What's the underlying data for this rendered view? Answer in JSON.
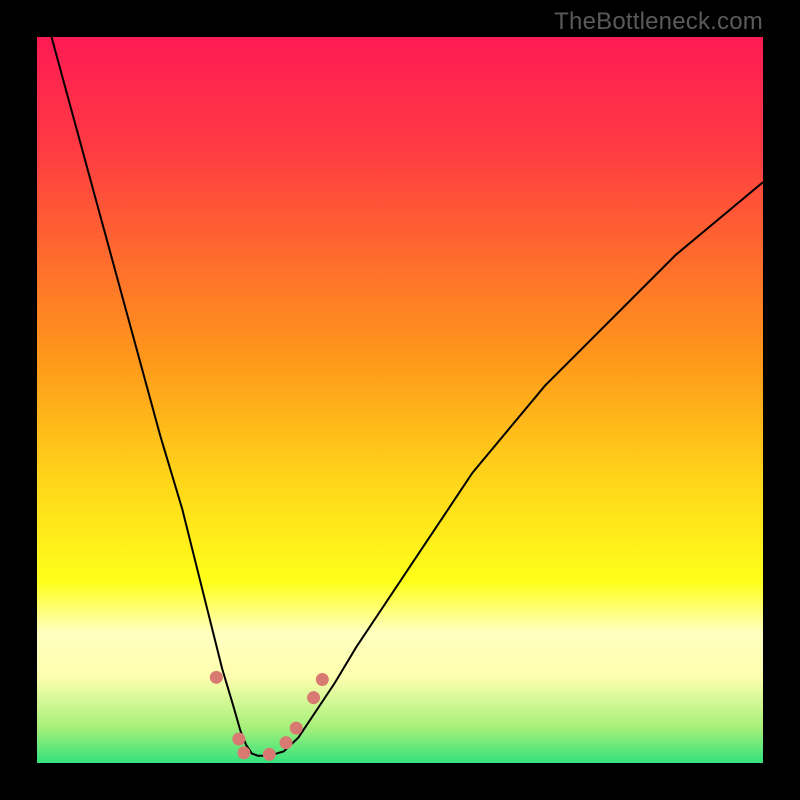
{
  "watermark": "TheBottleneck.com",
  "chart_data": {
    "type": "line",
    "title": "",
    "xlabel": "",
    "ylabel": "",
    "xlim": [
      0,
      100
    ],
    "ylim": [
      0,
      100
    ],
    "background": {
      "type": "vertical-gradient",
      "stops": [
        {
          "offset": 0.0,
          "color": "#ff1a54"
        },
        {
          "offset": 0.15,
          "color": "#ff3a43"
        },
        {
          "offset": 0.3,
          "color": "#ff6a2e"
        },
        {
          "offset": 0.45,
          "color": "#ff9a1a"
        },
        {
          "offset": 0.6,
          "color": "#ffd21a"
        },
        {
          "offset": 0.75,
          "color": "#ffff1a"
        },
        {
          "offset": 0.82,
          "color": "#ffffc0"
        },
        {
          "offset": 0.88,
          "color": "#ffffb0"
        },
        {
          "offset": 0.95,
          "color": "#a8f07a"
        },
        {
          "offset": 1.0,
          "color": "#33e27c"
        }
      ]
    },
    "series": [
      {
        "name": "bottleneck-curve",
        "color": "#000000",
        "stroke_width": 2,
        "x": [
          2,
          5,
          8,
          11,
          14,
          17,
          20,
          22,
          24,
          25.5,
          27,
          28,
          28.8,
          29.6,
          30.4,
          32,
          34,
          36,
          38,
          41,
          44,
          48,
          52,
          56,
          60,
          65,
          70,
          76,
          82,
          88,
          94,
          100
        ],
        "y": [
          100,
          89,
          78,
          67,
          56,
          45,
          35,
          27,
          19,
          13,
          8,
          4.5,
          2.5,
          1.3,
          1.0,
          1.0,
          1.6,
          3.5,
          6.5,
          11,
          16,
          22,
          28,
          34,
          40,
          46,
          52,
          58,
          64,
          70,
          75,
          80
        ]
      }
    ],
    "markers": [
      {
        "name": "marker-left",
        "x": 24.7,
        "y": 11.8,
        "r": 6.5,
        "color": "#d97a72"
      },
      {
        "name": "marker-left-lower",
        "x": 27.8,
        "y": 3.3,
        "r": 6.5,
        "color": "#d97a72"
      },
      {
        "name": "marker-trough-left",
        "x": 28.5,
        "y": 1.4,
        "r": 6.5,
        "color": "#d97a72"
      },
      {
        "name": "marker-trough-right",
        "x": 32.0,
        "y": 1.2,
        "r": 6.5,
        "color": "#d97a72"
      },
      {
        "name": "marker-right-lower-a",
        "x": 34.3,
        "y": 2.8,
        "r": 6.5,
        "color": "#d97a72"
      },
      {
        "name": "marker-right-lower-b",
        "x": 35.7,
        "y": 4.8,
        "r": 6.5,
        "color": "#d97a72"
      },
      {
        "name": "marker-right-upper-a",
        "x": 38.1,
        "y": 9.0,
        "r": 6.5,
        "color": "#d97a72"
      },
      {
        "name": "marker-right-upper-b",
        "x": 39.3,
        "y": 11.5,
        "r": 6.5,
        "color": "#d97a72"
      }
    ]
  }
}
